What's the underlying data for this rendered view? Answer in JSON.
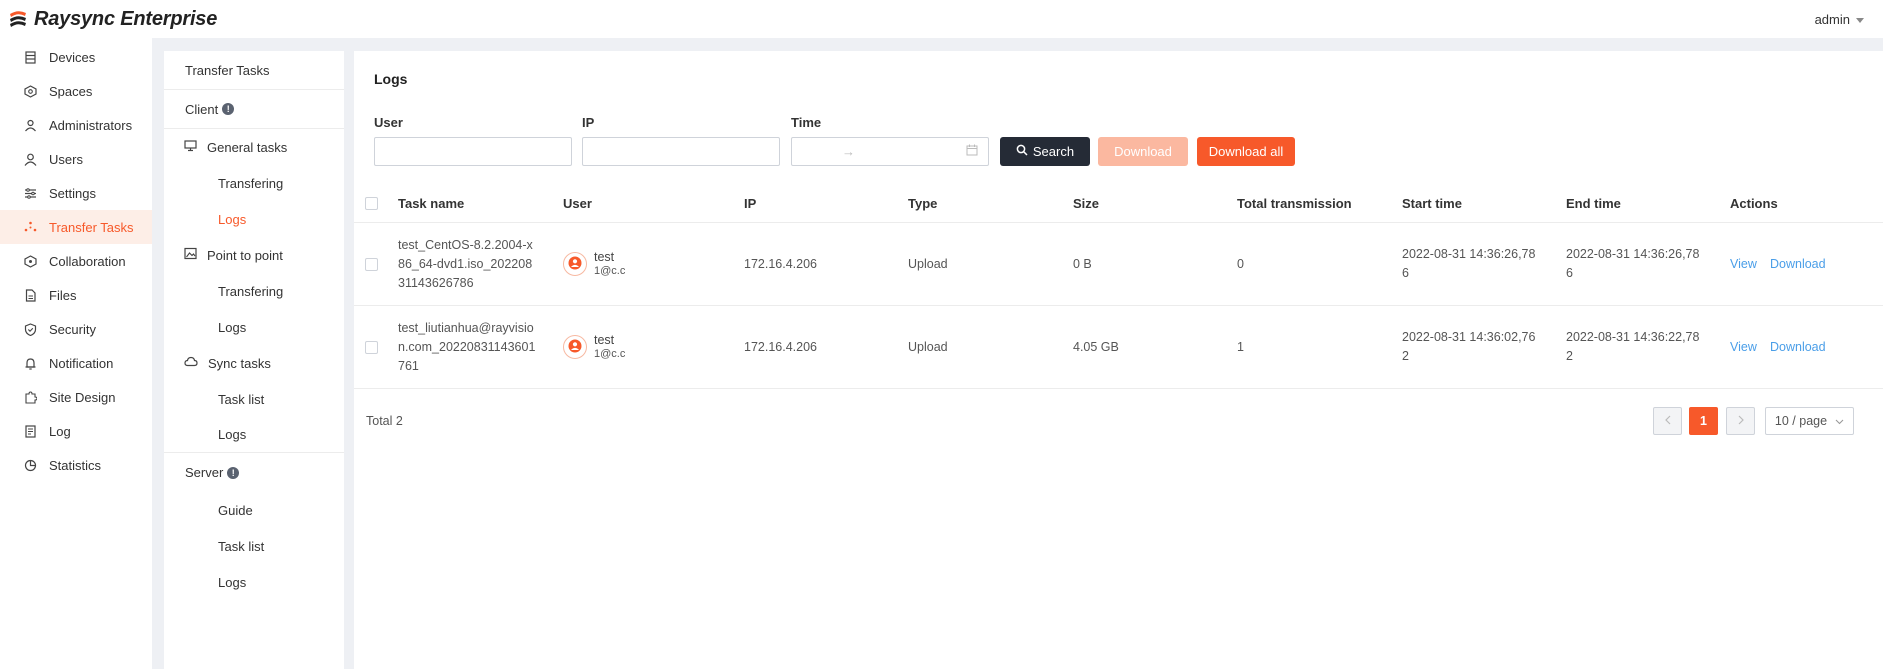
{
  "app": {
    "brand": "Raysync Enterprise",
    "user": "admin"
  },
  "sidebar": [
    {
      "label": "Devices",
      "icon": "devices-icon"
    },
    {
      "label": "Spaces",
      "icon": "spaces-icon"
    },
    {
      "label": "Administrators",
      "icon": "administrators-icon"
    },
    {
      "label": "Users",
      "icon": "users-icon"
    },
    {
      "label": "Settings",
      "icon": "settings-icon"
    },
    {
      "label": "Transfer Tasks",
      "icon": "transfer-tasks-icon",
      "active": true
    },
    {
      "label": "Collaboration",
      "icon": "collaboration-icon"
    },
    {
      "label": "Files",
      "icon": "files-icon"
    },
    {
      "label": "Security",
      "icon": "security-icon"
    },
    {
      "label": "Notification",
      "icon": "notification-icon"
    },
    {
      "label": "Site Design",
      "icon": "site-design-icon"
    },
    {
      "label": "Log",
      "icon": "log-icon"
    },
    {
      "label": "Statistics",
      "icon": "statistics-icon"
    }
  ],
  "subnav": {
    "title": "Transfer Tasks",
    "client": "Client",
    "general_tasks": "General tasks",
    "general_transfering": "Transfering",
    "general_logs": "Logs",
    "point_to_point": "Point to point",
    "p2p_transfering": "Transfering",
    "p2p_logs": "Logs",
    "sync_tasks": "Sync tasks",
    "sync_task_list": "Task list",
    "sync_logs": "Logs",
    "server": "Server",
    "server_guide": "Guide",
    "server_task_list": "Task list",
    "server_logs": "Logs"
  },
  "page": {
    "title": "Logs",
    "filters": {
      "user_label": "User",
      "ip_label": "IP",
      "time_label": "Time",
      "range_separator": "→"
    },
    "buttons": {
      "search": "Search",
      "download": "Download",
      "download_all": "Download all"
    }
  },
  "table": {
    "headers": {
      "task_name": "Task name",
      "user": "User",
      "ip": "IP",
      "type": "Type",
      "size": "Size",
      "total_transmission": "Total transmission",
      "start_time": "Start time",
      "end_time": "End time",
      "actions": "Actions"
    },
    "rows": [
      {
        "task_name_lines": [
          "test_CentOS-8.2.2004-x",
          "86_64-dvd1.iso_202208",
          "31143626786"
        ],
        "user_name": "test",
        "user_email": "1@c.c",
        "ip": "172.16.4.206",
        "type": "Upload",
        "size": "0 B",
        "total": "0",
        "start_lines": [
          "2022-08-31 14:36:26,78",
          "6"
        ],
        "end_lines": [
          "2022-08-31 14:36:26,78",
          "6"
        ],
        "view": "View",
        "download": "Download"
      },
      {
        "task_name_lines": [
          "test_liutianhua@rayvisio",
          "n.com_20220831143601",
          "761"
        ],
        "user_name": "test",
        "user_email": "1@c.c",
        "ip": "172.16.4.206",
        "type": "Upload",
        "size": "4.05 GB",
        "total": "1",
        "start_lines": [
          "2022-08-31 14:36:02,76",
          "2"
        ],
        "end_lines": [
          "2022-08-31 14:36:22,78",
          "2"
        ],
        "view": "View",
        "download": "Download"
      }
    ]
  },
  "pagination": {
    "total": "Total 2",
    "current": "1",
    "page_size": "10 / page"
  },
  "colors": {
    "accent": "#f7592a",
    "accent_light": "#fbb8a0",
    "dark": "#252b36",
    "link": "#4a9ee8"
  }
}
